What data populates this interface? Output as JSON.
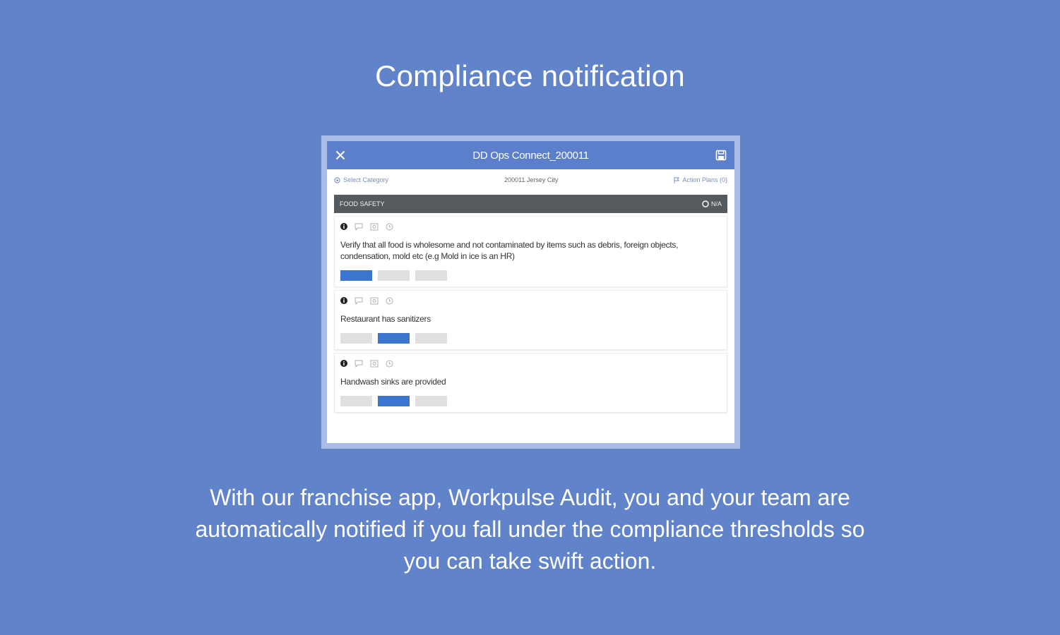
{
  "headline": "Compliance notification",
  "app": {
    "title": "DD Ops Connect_200011",
    "subbar": {
      "left": "Select Category",
      "center": "200011 Jersey City",
      "right": "Action Plans (0)"
    },
    "section": {
      "title": "FOOD SAFETY",
      "na_label": "N/A"
    },
    "items": [
      {
        "text": "Verify that all food is wholesome and not contaminated by items such as debris, foreign objects, condensation, mold etc (e.g Mold in ice is an HR)",
        "selected": 0
      },
      {
        "text": "Restaurant has sanitizers",
        "selected": 1
      },
      {
        "text": "Handwash sinks are provided",
        "selected": 1
      }
    ]
  },
  "caption": "With our franchise app, Workpulse Audit, you and your team are automatically notified if you fall under the compliance thresholds so you can take swift action.",
  "colors": {
    "background": "#6083c9",
    "appbar": "#5b7fcb",
    "selected_option": "#3d74cf",
    "section_bar": "#555a5e"
  }
}
